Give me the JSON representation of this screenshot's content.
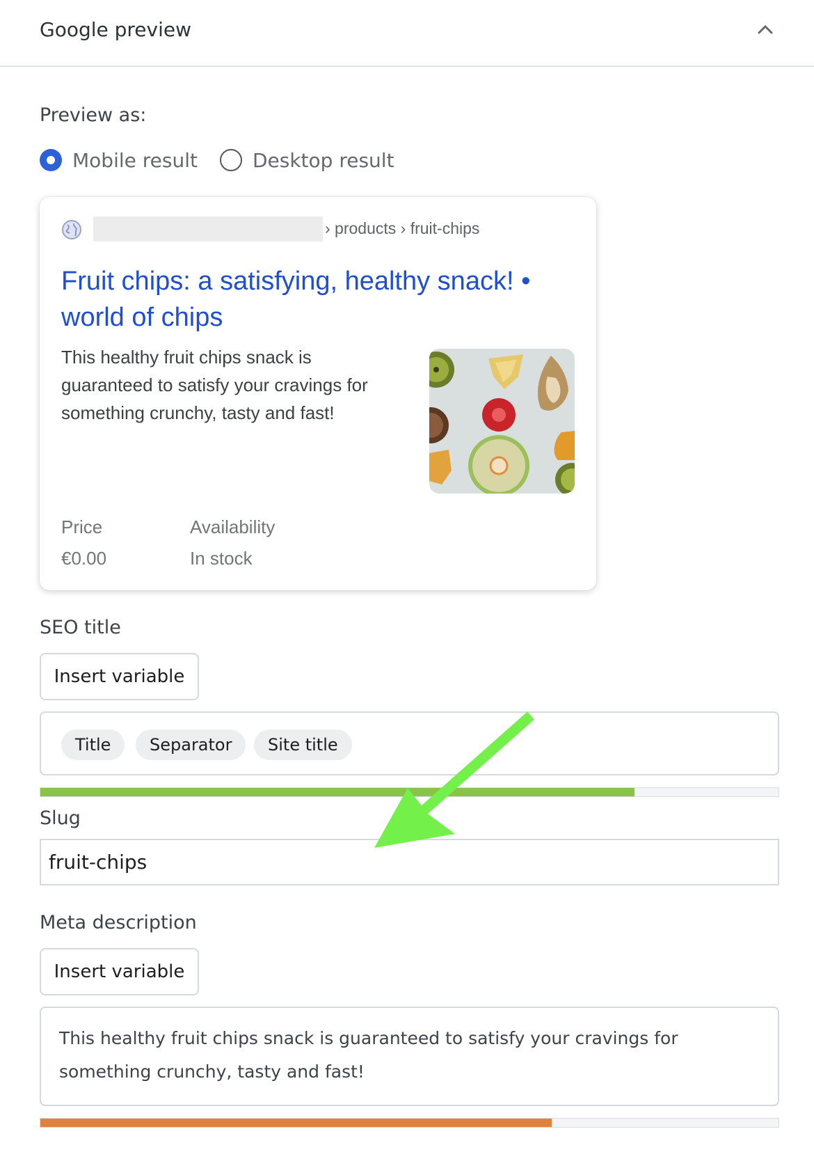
{
  "header": {
    "title": "Google preview",
    "collapse_icon": "chevron-up-icon"
  },
  "preview": {
    "label": "Preview as:",
    "options": [
      {
        "label": "Mobile result",
        "selected": true
      },
      {
        "label": "Desktop result",
        "selected": false
      }
    ]
  },
  "card": {
    "breadcrumb": "› products › fruit-chips",
    "title": "Fruit chips: a satisfying, healthy snack! • world of chips",
    "snippet": "This healthy fruit chips snack is guaranteed to satisfy your cravings for something crunchy, tasty and fast!",
    "price_label": "Price",
    "price_value": "€0.00",
    "availability_label": "Availability",
    "availability_value": "In stock"
  },
  "seo_title": {
    "label": "SEO title",
    "insert_button": "Insert variable",
    "pills": [
      "Title",
      "Separator",
      "Site title"
    ],
    "progress": 0.805,
    "progress_color": "#8bc34a"
  },
  "slug": {
    "label": "Slug",
    "value": "fruit-chips"
  },
  "meta_description": {
    "label": "Meta description",
    "insert_button": "Insert variable",
    "value": "This healthy fruit chips snack is guaranteed to satisfy your cravings for something crunchy, tasty and fast!",
    "progress": 0.693,
    "progress_color": "#e0823d"
  },
  "colors": {
    "accent": "#2c62d8",
    "link": "#1f4fcf",
    "annotation_arrow": "#74f04b"
  }
}
